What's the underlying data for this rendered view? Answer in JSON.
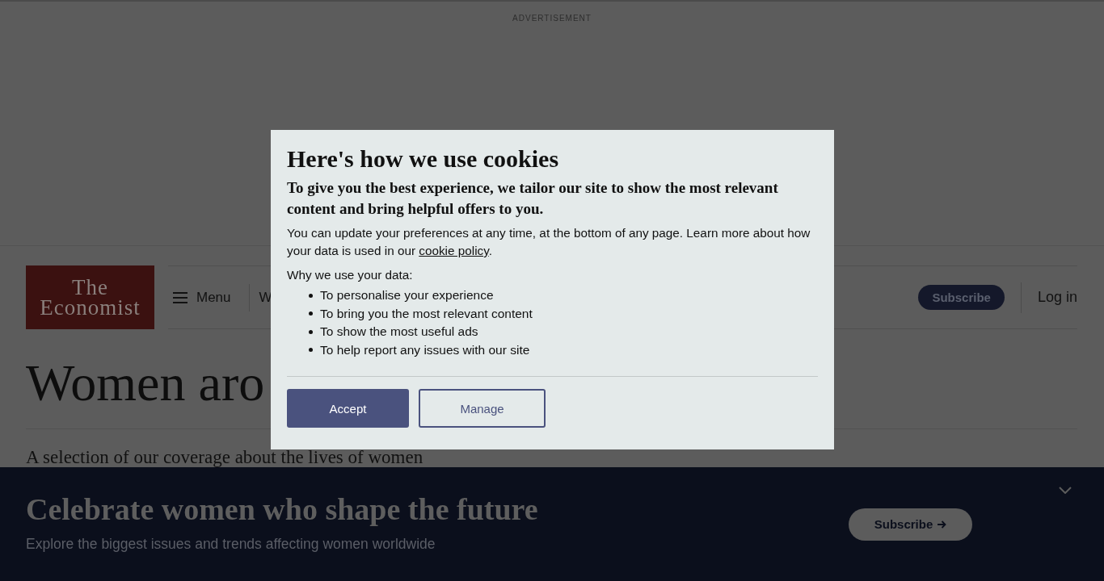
{
  "advertisement": {
    "label": "ADVERTISEMENT"
  },
  "header": {
    "logo": "The Economist",
    "menu_button": "Menu",
    "nav_items": [
      "W"
    ],
    "subscribe_button": "Subscribe",
    "login_link": "Log in"
  },
  "page": {
    "title": "Women aro",
    "subtitle": "A selection of our coverage about the lives of women"
  },
  "cookie_dialog": {
    "title": "Here's how we use cookies",
    "lead": "To give you the best experience, we tailor our site to show the most relevant content and bring helpful offers to you.",
    "body": {
      "before": "You can update your preferences at any time, at the bottom of any page. Learn more about how your data is used in our ",
      "link": "cookie policy",
      "after": "."
    },
    "list_heading": "Why we use your data:",
    "reasons": [
      "To personalise your experience",
      "To bring you the most relevant content",
      "To show the most useful ads",
      "To help report any issues with our site"
    ],
    "buttons": [
      {
        "label": "Accept",
        "kind": "primary"
      },
      {
        "label": "Manage",
        "kind": "secondary"
      }
    ]
  },
  "promo_banner": {
    "title": "Celebrate women who shape the future",
    "text": "Explore the biggest issues and trends affecting women worldwide",
    "button": "Subscribe"
  }
}
